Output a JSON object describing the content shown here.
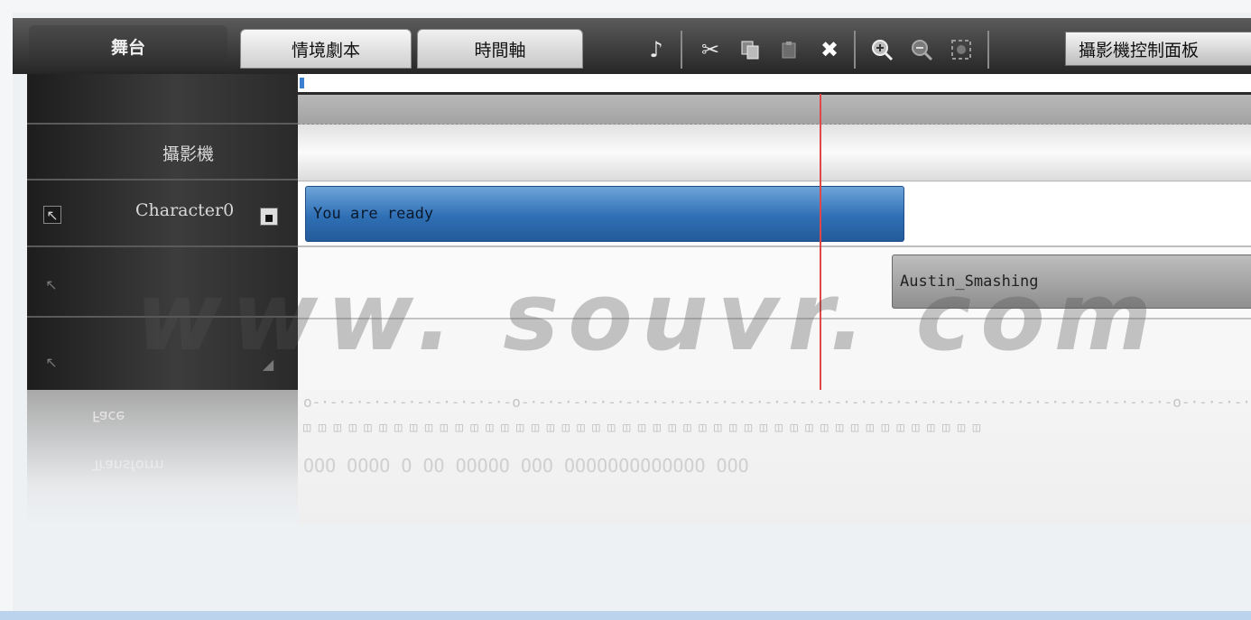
{
  "tabs": {
    "stage": "舞台",
    "script": "情境劇本",
    "timeline": "時間軸"
  },
  "toolbar": {
    "icons": [
      "music-note-icon",
      "cut-icon",
      "copy-icon",
      "paste-icon",
      "delete-icon",
      "zoom-in-icon",
      "zoom-out-icon",
      "zoom-fit-icon"
    ],
    "camera_panel_label": "攝影機控制面板"
  },
  "tracks": {
    "camera_label": "攝影機",
    "character_label": "Character0"
  },
  "clips": {
    "dialogue": "You are ready",
    "motion": "Austin_Smashing"
  },
  "reflection": {
    "face_label": "Face",
    "transform_label": "Transform"
  },
  "watermark": "www. souvr. com",
  "colors": {
    "clip_blue": "#2f6fb5",
    "playhead": "#e04848",
    "panel_dark": "#2a2a2a"
  }
}
